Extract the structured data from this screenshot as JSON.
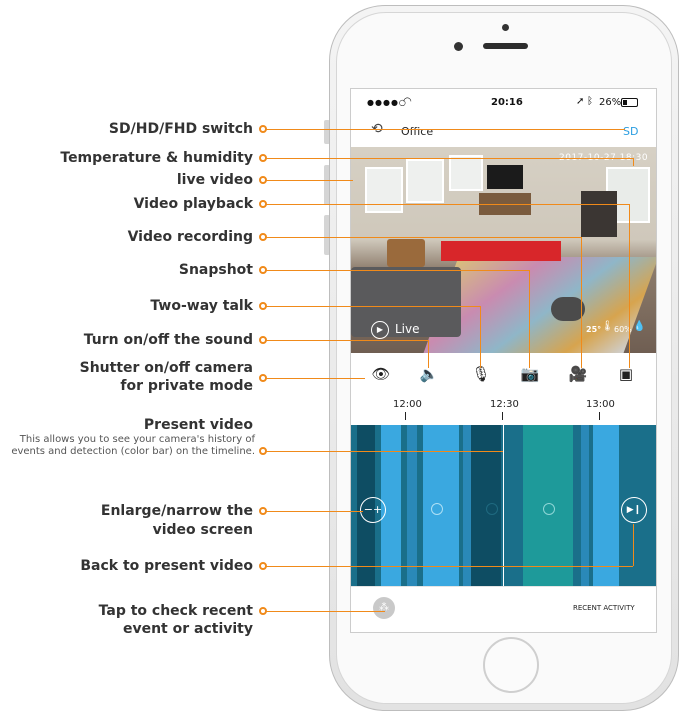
{
  "labels": {
    "sd_switch": "SD/HD/FHD switch",
    "temp_humidity": "Temperature & humidity",
    "live_video": "live video",
    "playback": "Video playback",
    "recording": "Video recording",
    "snapshot": "Snapshot",
    "two_way": "Two-way talk",
    "sound": "Turn on/off the sound",
    "shutter_1": "Shutter on/off camera",
    "shutter_2": "for private mode",
    "present": "Present video",
    "present_desc": "This allows you to see your camera's history of events and detection (color bar) on the timeline.",
    "enlarge_1": "Enlarge/narrow the",
    "enlarge_2": "video screen",
    "back": "Back to present video",
    "tap_1": "Tap to check recent",
    "tap_2": "event  or activity"
  },
  "status_bar": {
    "signal": "●●●●○",
    "time": "20:16",
    "battery": "26%"
  },
  "nav": {
    "back_glyph": "⟲",
    "title": "Office",
    "quality": "SD"
  },
  "video": {
    "timestamp": "2017-10-27  18:30",
    "live_label": "Live",
    "temperature": "25°",
    "humidity": "60%"
  },
  "timeline": {
    "ticks": [
      "12:00",
      "12:30",
      "13:00"
    ]
  },
  "bottom": {
    "recent": "RECENT ACTIVITY"
  },
  "colors": {
    "accent": "#f08a1a",
    "timeline_light": "#3aa8e0",
    "timeline_dark": "#0e4d63",
    "timeline_teal": "#1e9a9a",
    "sd_blue": "#2a9de0"
  }
}
